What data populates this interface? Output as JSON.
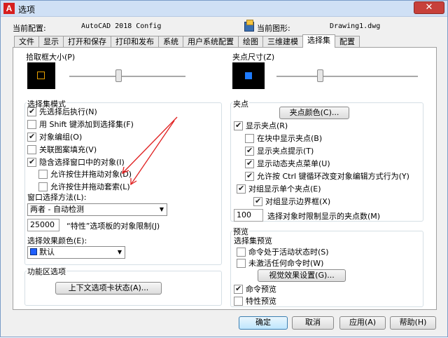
{
  "window": {
    "title": "选项",
    "close": "✕"
  },
  "header": {
    "profile_label": "当前配置:",
    "profile_value": "AutoCAD 2018 Config",
    "drawing_label": "当前图形:",
    "drawing_value": "Drawing1.dwg"
  },
  "tabs": [
    "文件",
    "显示",
    "打开和保存",
    "打印和发布",
    "系统",
    "用户系统配置",
    "绘图",
    "三维建模",
    "选择集",
    "配置"
  ],
  "active_tab": 8,
  "pickbox": {
    "label": "拾取框大小(P)",
    "level": 0.42
  },
  "grip_size": {
    "label": "夹点尺寸(Z)",
    "level": 0.3
  },
  "selection_modes": {
    "label": "选择集模式",
    "items": [
      {
        "label": "先选择后执行(N)",
        "checked": true
      },
      {
        "label": "用 Shift 键添加到选择集(F)",
        "checked": false
      },
      {
        "label": "对象编组(O)",
        "checked": true
      },
      {
        "label": "关联图案填充(V)",
        "checked": false
      },
      {
        "label": "隐含选择窗口中的对象(I)",
        "checked": true
      },
      {
        "label": "允许按住并拖动对象(D)",
        "checked": false
      },
      {
        "label": "允许按住并拖动套索(L)",
        "checked": false
      }
    ],
    "window_method_label": "窗口选择方法(L):",
    "window_method_value": "两者 - 自动检测",
    "limit_value": "25000",
    "limit_label": "“特性”选项板的对象限制(J)",
    "effect_color_label": "选择效果颜色(E):",
    "effect_color_value": "默认"
  },
  "ribbon": {
    "label": "功能区选项",
    "button": "上下文选项卡状态(A)..."
  },
  "grips": {
    "label": "夹点",
    "color_button": "夹点颜色(C)...",
    "items": [
      {
        "label": "显示夹点(R)",
        "checked": true
      },
      {
        "label": "在块中显示夹点(B)",
        "checked": false
      },
      {
        "label": "显示夹点提示(T)",
        "checked": true
      },
      {
        "label": "显示动态夹点菜单(U)",
        "checked": true
      },
      {
        "label": "允许按 Ctrl 键循环改变对象编辑方式行为(Y)",
        "checked": true
      },
      {
        "label": "对组显示单个夹点(E)",
        "checked": true
      },
      {
        "label": "对组显示边界框(X)",
        "checked": true
      }
    ],
    "limit_value": "100",
    "limit_label": "选择对象时限制显示的夹点数(M)"
  },
  "preview": {
    "label": "预览",
    "sub_label": "选择集预览",
    "items": [
      {
        "label": "命令处于活动状态时(S)",
        "checked": false
      },
      {
        "label": "未激活任何命令时(W)",
        "checked": false
      }
    ],
    "effects_button": "视觉效果设置(G)...",
    "cmd_preview": {
      "label": "命令预览",
      "checked": true
    },
    "prop_preview": {
      "label": "特性预览",
      "checked": false
    }
  },
  "footer": {
    "ok": "确定",
    "cancel": "取消",
    "apply": "应用(A)",
    "help": "帮助(H)"
  },
  "colors": {
    "pickbox_square": "#e8a000",
    "grip_square": "#1e7bff",
    "annotation": "#e02020"
  }
}
